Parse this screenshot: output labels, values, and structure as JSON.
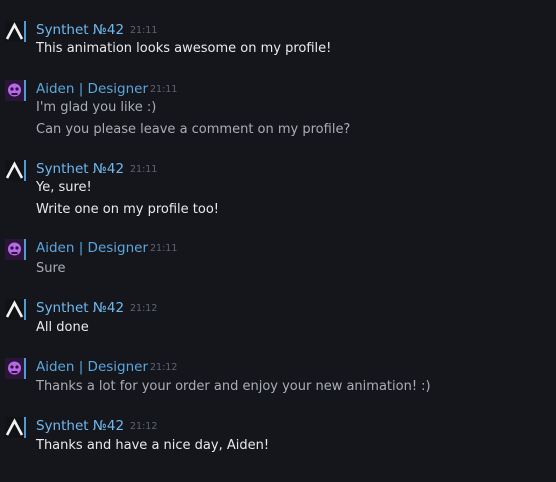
{
  "messages": [
    {
      "author": "Synthet №42",
      "time": "21:11",
      "lines": [
        "This animation looks awesome on my profile!"
      ]
    },
    {
      "author": "Aiden | Designer",
      "time": "21:11",
      "lines": [
        "I'm glad you like :)",
        "Can you please leave a comment on my profile?"
      ]
    },
    {
      "author": "Synthet №42",
      "time": "21:11",
      "lines": [
        "Ye, sure!",
        "Write one on my profile too!"
      ]
    },
    {
      "author": "Aiden | Designer",
      "time": "21:11",
      "lines": [
        "Sure"
      ]
    },
    {
      "author": "Synthet №42",
      "time": "21:12",
      "lines": [
        "All done"
      ]
    },
    {
      "author": "Aiden | Designer",
      "time": "21:12",
      "lines": [
        "Thanks a lot for your order and enjoy your new animation! :)"
      ]
    },
    {
      "author": "Synthet №42",
      "time": "21:12",
      "lines": [
        "Thanks and have a nice day, Aiden!"
      ]
    }
  ],
  "icons": {
    "synthet_avatar": "synthet-logo-icon",
    "aiden_avatar": "purple-skull-avatar-icon"
  },
  "colors": {
    "background": "#15161b",
    "name_link": "#6fb8f0",
    "message_text": "#e8eaed",
    "timestamp": "#5d6470"
  }
}
